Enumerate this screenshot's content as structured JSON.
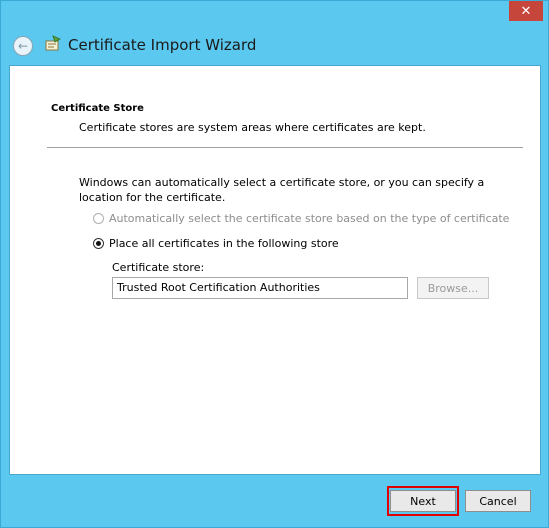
{
  "window": {
    "title": "Certificate Import Wizard",
    "close_glyph": "✕",
    "back_glyph": "←"
  },
  "page": {
    "section_title": "Certificate Store",
    "section_desc": "Certificate stores are system areas where certificates are kept.",
    "intro": "Windows can automatically select a certificate store, or you can specify a location for the certificate.",
    "options": [
      {
        "label": "Automatically select the certificate store based on the type of certificate",
        "selected": false,
        "disabled": true
      },
      {
        "label": "Place all certificates in the following store",
        "selected": true,
        "disabled": false
      }
    ],
    "store_label": "Certificate store:",
    "store_value": "Trusted Root Certification Authorities",
    "browse_label": "Browse..."
  },
  "footer": {
    "next_label": "Next",
    "cancel_label": "Cancel",
    "highlight_color": "#e00000"
  },
  "icons": [
    "back-arrow-icon",
    "certificate-wizard-icon",
    "close-icon"
  ]
}
